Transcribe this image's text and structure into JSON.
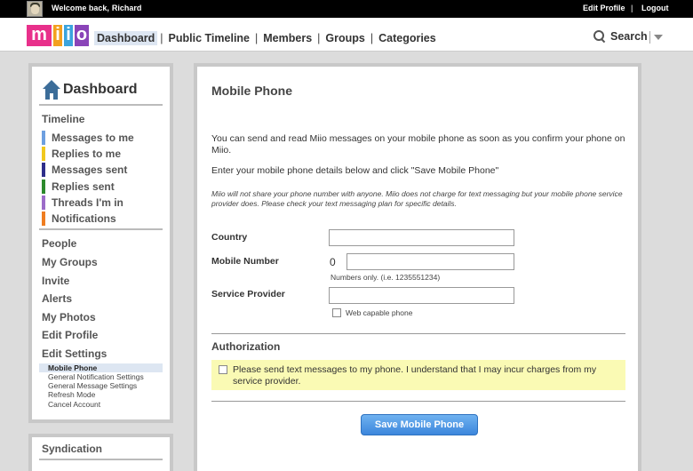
{
  "topbar": {
    "welcome": "Welcome back,",
    "username": "Richard",
    "edit_profile": "Edit Profile",
    "separator": "|",
    "logout": "Logout"
  },
  "brand": {
    "logo_letters": [
      "m",
      "i",
      "i",
      "o"
    ],
    "logo_colors": [
      "#e8308b",
      "#f3a01f",
      "#3aa4de",
      "#8a44b8"
    ]
  },
  "nav": {
    "items": [
      {
        "label": "Dashboard",
        "active": true
      },
      {
        "label": "Public Timeline"
      },
      {
        "label": "Members"
      },
      {
        "label": "Groups"
      },
      {
        "label": "Categories"
      }
    ],
    "separator": "|",
    "search_label": "Search"
  },
  "sidebar": {
    "title": "Dashboard",
    "timeline_label": "Timeline",
    "timeline_items": [
      {
        "label": "Messages to me",
        "color": "#6d9fe0"
      },
      {
        "label": "Replies to me",
        "color": "#f1c81e"
      },
      {
        "label": "Messages sent",
        "color": "#2e2e8a"
      },
      {
        "label": "Replies sent",
        "color": "#2d8a2d"
      },
      {
        "label": "Threads I'm in",
        "color": "#9c6cc8"
      },
      {
        "label": "Notifications",
        "color": "#ef7d21"
      }
    ],
    "links": [
      "People",
      "My Groups",
      "Invite",
      "Alerts",
      "My Photos",
      "Edit Profile",
      "Edit Settings"
    ],
    "settings_sub": [
      {
        "label": "Mobile Phone",
        "active": true
      },
      {
        "label": "General Notification Settings"
      },
      {
        "label": "General Message Settings"
      },
      {
        "label": "Refresh Mode"
      },
      {
        "label": "Cancel Account"
      }
    ],
    "syndication_title": "Syndication"
  },
  "main": {
    "title": "Mobile Phone",
    "intro": "You can send and read Miio messages on your mobile phone as soon as you confirm your phone on Miio.",
    "instructions": "Enter your mobile phone details below and click \"Save Mobile Phone\"",
    "privacy": "Miio will not share your phone number with anyone. Miio does not charge for text messaging but your mobile phone service provider does. Please check your text messaging plan for specific details.",
    "country_label": "Country",
    "country_value": "",
    "mobile_label": "Mobile Number",
    "mobile_prefix": "0",
    "mobile_value": "",
    "mobile_hint": "Numbers only. (i.e. 1235551234)",
    "provider_label": "Service Provider",
    "provider_value": "",
    "web_capable_label": "Web capable phone",
    "auth_title": "Authorization",
    "auth_text": "Please send text messages to my phone. I understand that I may incur charges from my service provider.",
    "save_button": "Save Mobile Phone"
  }
}
